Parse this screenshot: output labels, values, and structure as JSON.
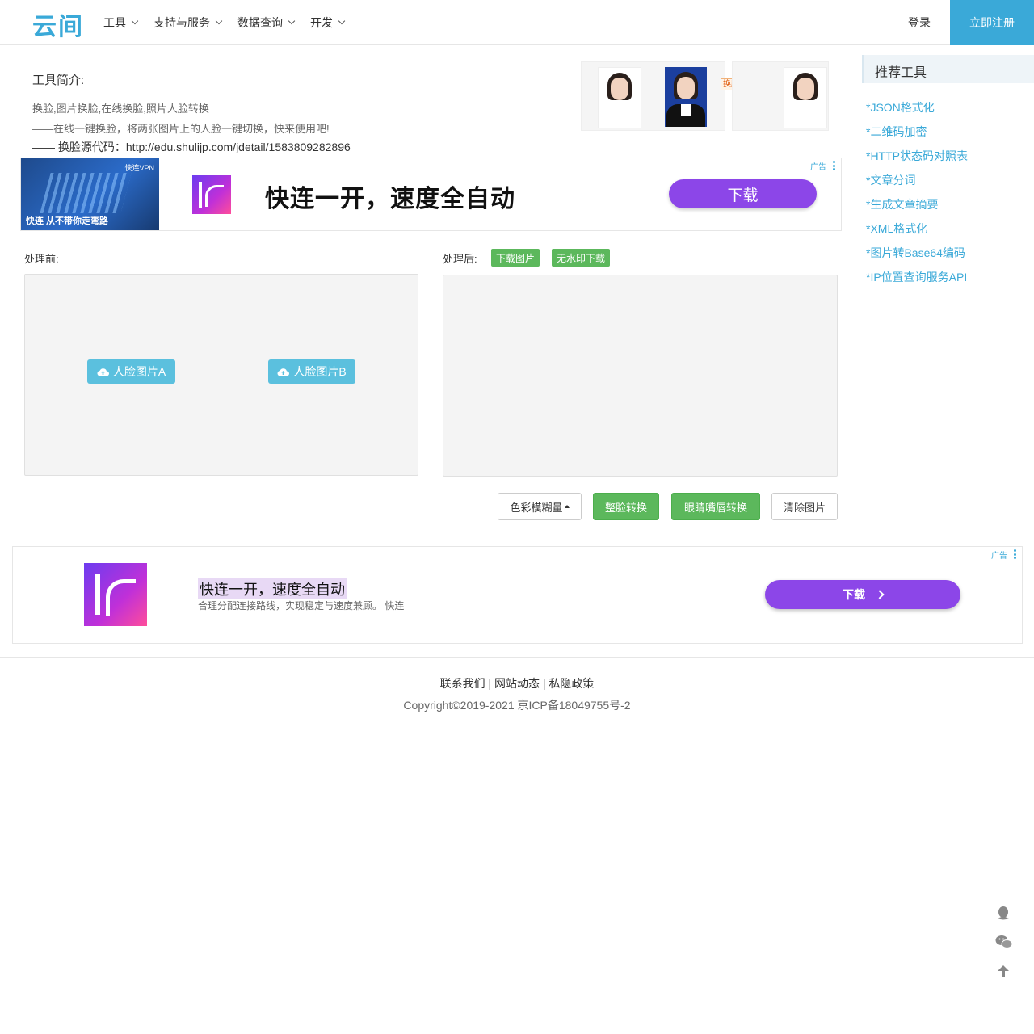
{
  "header": {
    "logo": "云间",
    "nav": [
      "工具",
      "支持与服务",
      "数据查询",
      "开发"
    ],
    "login": "登录",
    "register": "立即注册"
  },
  "intro": {
    "title": "工具简介:",
    "line1": "换脸,图片换脸,在线换脸,照片人脸转换",
    "line2": "——在线一键换脸，将两张图片上的人脸一键切换，快来使用吧!",
    "code": "—— 换脸源代码：http://edu.shulijp.com/jdetail/1583809282896",
    "example_label": "换脸效果"
  },
  "ad1": {
    "tag": "广告",
    "image_tag": "快连VPN",
    "image_text": "快连 从不带你走弯路",
    "headline": "快连一开，速度全自动",
    "button": "下载"
  },
  "work": {
    "before_label": "处理前:",
    "after_label": "处理后:",
    "download_btn": "下载图片",
    "nowm_btn": "无水印下载",
    "face_a": "人脸图片A",
    "face_b": "人脸图片B",
    "blur_btn": "色彩模糊量",
    "whole_btn": "整脸转换",
    "eyes_btn": "眼睛嘴唇转换",
    "clear_btn": "清除图片"
  },
  "sidebar": {
    "title": "推荐工具",
    "links": [
      "*JSON格式化",
      "*二维码加密",
      "*HTTP状态码对照表",
      "*文章分词",
      "*生成文章摘要",
      "*XML格式化",
      "*图片转Base64编码",
      "*IP位置查询服务API"
    ]
  },
  "ad2": {
    "tag": "广告",
    "headline": "快连一开，速度全自动",
    "sub": "合理分配连接路线，实现稳定与速度兼顾。 快连",
    "button": "下载"
  },
  "footer": {
    "links": [
      "联系我们",
      "网站动态",
      "私隐政策"
    ],
    "copyright": "Copyright©2019-2021 京ICP备18049755号-2"
  },
  "colors": {
    "accent": "#3aa9d8",
    "green": "#5cb85c",
    "upload": "#5bc0de",
    "ad_purple": "#8c46e8"
  },
  "icons": [
    "chevron-down-icon",
    "cloud-upload-icon",
    "qq-icon",
    "wechat-icon",
    "arrow-up-icon",
    "more-icon"
  ]
}
